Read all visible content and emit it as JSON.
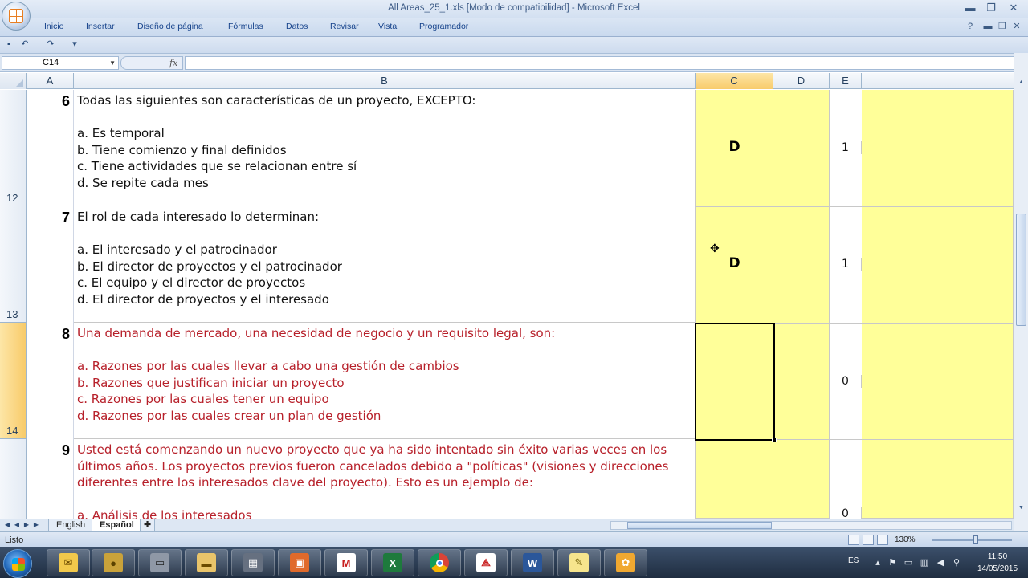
{
  "window": {
    "title": "All Areas_25_1.xls  [Modo de compatibilidad] - Microsoft Excel",
    "minimize": "▬",
    "maximize": "❐",
    "close": "✕"
  },
  "ribbon": {
    "tabs": [
      "Inicio",
      "Insertar",
      "Diseño de página",
      "Fórmulas",
      "Datos",
      "Revisar",
      "Vista",
      "Programador"
    ]
  },
  "formula_bar": {
    "name_box": "C14",
    "fx": "fx",
    "formula": ""
  },
  "columns": [
    "A",
    "B",
    "C",
    "D",
    "E"
  ],
  "active_column": "C",
  "rows": [
    {
      "row": "12",
      "number": "6",
      "question": "Todas las siguientes son características de un proyecto, EXCEPTO:",
      "options": [
        "a. Es temporal",
        "b. Tiene comienzo y final definidos",
        "c. Tiene actividades que se relacionan entre sí",
        "d. Se repite cada mes"
      ],
      "answer": "D",
      "score": "1",
      "color": "#111111"
    },
    {
      "row": "13",
      "number": "7",
      "question": "El rol de cada interesado lo determinan:",
      "options": [
        "a. El interesado y el patrocinador",
        "b. El director de proyectos y el patrocinador",
        "c. El equipo y el director de proyectos",
        "d. El director de proyectos y el interesado"
      ],
      "answer": "D",
      "score": "1",
      "color": "#111111"
    },
    {
      "row": "14",
      "number": "8",
      "question": "Una demanda de mercado, una necesidad de negocio y un requisito legal, son:",
      "options": [
        "a. Razones por las cuales llevar a cabo una gestión de cambios",
        "b. Razones que justifican iniciar un proyecto",
        "c. Razones por las cuales tener un equipo",
        "d. Razones por las cuales crear un plan de gestión"
      ],
      "answer": "",
      "score": "0",
      "color": "#b7202a"
    },
    {
      "row": "",
      "number": "9",
      "question": "Usted está comenzando un nuevo proyecto que ya ha sido intentado sin éxito varias veces en los últimos años. Los proyectos previos fueron cancelados debido a \"políticas\" (visiones y direcciones diferentes entre los interesados clave del proyecto). Esto es un ejemplo de:",
      "options": [
        "a. Análisis de los interesados"
      ],
      "answer": "",
      "score": "0",
      "color": "#b7202a"
    }
  ],
  "sheet_tabs": [
    "English",
    "Español"
  ],
  "active_sheet": "Español",
  "status": {
    "text": "Listo",
    "zoom": "130%"
  },
  "taskbar": {
    "language": "ES",
    "time": "11:50",
    "date": "14/05/2015",
    "apps": [
      "outlook-icon",
      "coins-icon",
      "scanner-icon",
      "folder-icon",
      "calculator-icon",
      "slides-icon",
      "m-icon",
      "excel-icon",
      "chrome-icon",
      "pdf-icon",
      "word-icon",
      "notes-icon",
      "flower-icon"
    ]
  }
}
